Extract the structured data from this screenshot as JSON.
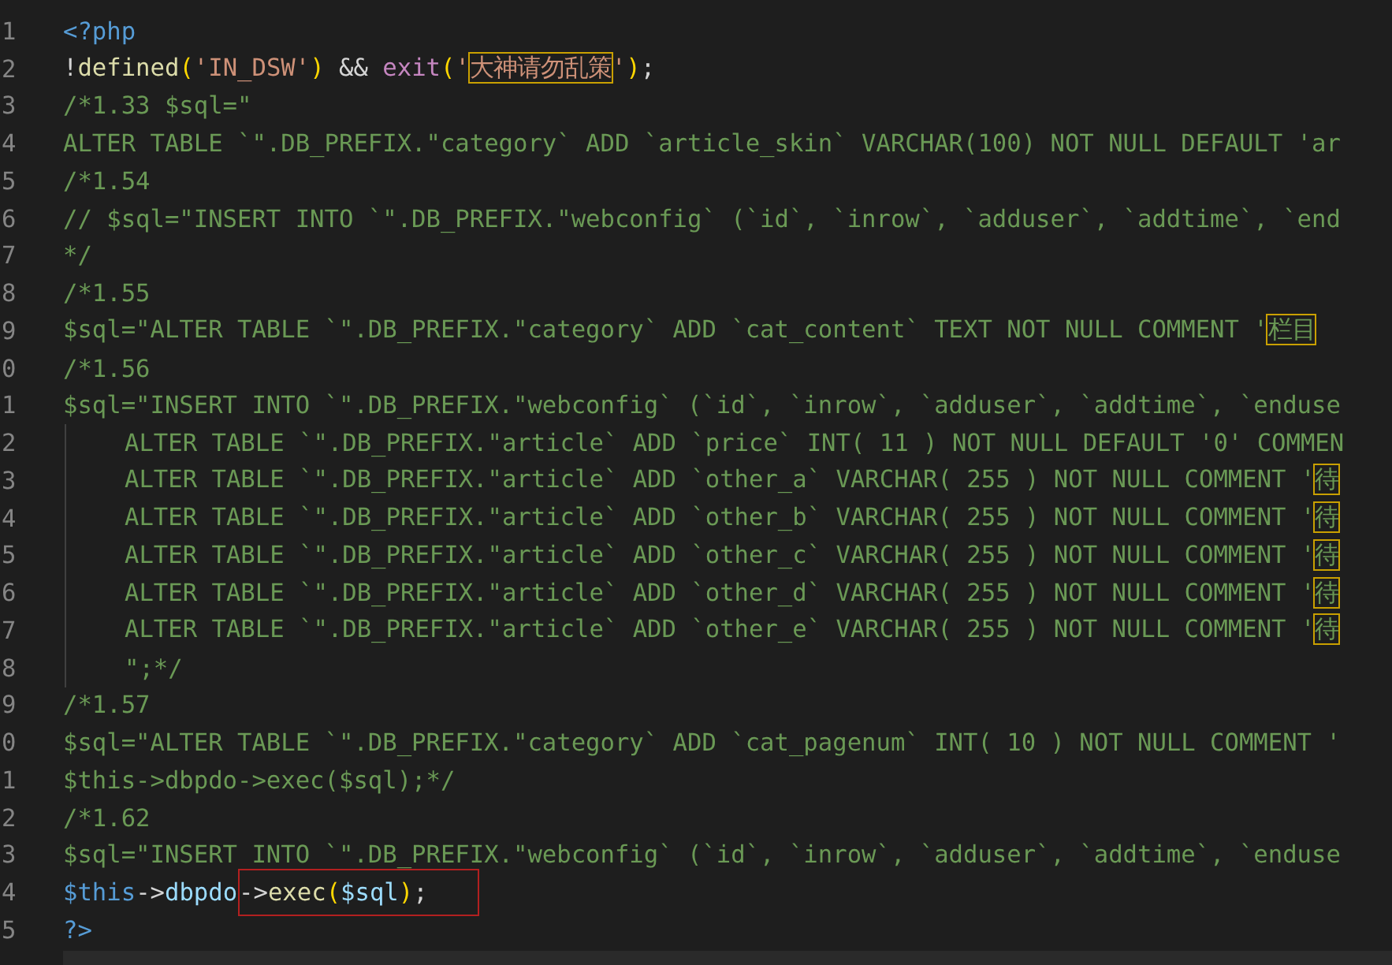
{
  "editor": {
    "lines": [
      {
        "number": "1",
        "indented": false,
        "tokens": [
          {
            "kind": "tag",
            "text": "<?php"
          }
        ]
      },
      {
        "number": "2",
        "indented": false,
        "tokens": [
          {
            "kind": "plain",
            "text": "!"
          },
          {
            "kind": "func",
            "text": "defined"
          },
          {
            "kind": "bracket",
            "text": "("
          },
          {
            "kind": "string",
            "text": "'IN_DSW'"
          },
          {
            "kind": "bracket",
            "text": ")"
          },
          {
            "kind": "plain",
            "text": " && "
          },
          {
            "kind": "control",
            "text": "exit"
          },
          {
            "kind": "bracket",
            "text": "("
          },
          {
            "kind": "string",
            "text": "'"
          },
          {
            "kind": "string-flagged",
            "text": "大神请勿乱策"
          },
          {
            "kind": "string",
            "text": "'"
          },
          {
            "kind": "bracket",
            "text": ")"
          },
          {
            "kind": "plain",
            "text": ";"
          }
        ]
      },
      {
        "number": "3",
        "indented": false,
        "tokens": [
          {
            "kind": "comment",
            "text": "/*1.33 $sql=\""
          }
        ]
      },
      {
        "number": "4",
        "indented": false,
        "tokens": [
          {
            "kind": "comment",
            "text": "ALTER TABLE `\".DB_PREFIX.\"category` ADD `article_skin` VARCHAR(100) NOT NULL DEFAULT 'ar"
          }
        ]
      },
      {
        "number": "5",
        "indented": false,
        "tokens": [
          {
            "kind": "comment",
            "text": "/*1.54"
          }
        ]
      },
      {
        "number": "6",
        "indented": false,
        "tokens": [
          {
            "kind": "comment",
            "text": "// $sql=\"INSERT INTO `\".DB_PREFIX.\"webconfig` (`id`, `inrow`, `adduser`, `addtime`, `end"
          }
        ]
      },
      {
        "number": "7",
        "indented": false,
        "tokens": [
          {
            "kind": "comment",
            "text": "*/"
          }
        ]
      },
      {
        "number": "8",
        "indented": false,
        "tokens": [
          {
            "kind": "comment",
            "text": "/*1.55"
          }
        ]
      },
      {
        "number": "9",
        "indented": false,
        "tokens": [
          {
            "kind": "comment",
            "text": "$sql=\"ALTER TABLE `\".DB_PREFIX.\"category` ADD `cat_content` TEXT NOT NULL COMMENT '"
          },
          {
            "kind": "comment-flagged",
            "text": "栏目"
          }
        ]
      },
      {
        "number": "0",
        "indented": false,
        "tokens": [
          {
            "kind": "comment",
            "text": "/*1.56"
          }
        ]
      },
      {
        "number": "1",
        "indented": false,
        "tokens": [
          {
            "kind": "comment",
            "text": "$sql=\"INSERT INTO `\".DB_PREFIX.\"webconfig` (`id`, `inrow`, `adduser`, `addtime`, `enduse"
          }
        ]
      },
      {
        "number": "2",
        "indented": true,
        "tokens": [
          {
            "kind": "comment",
            "text": "ALTER TABLE `\".DB_PREFIX.\"article` ADD `price` INT( 11 ) NOT NULL DEFAULT '0' COMMEN"
          }
        ]
      },
      {
        "number": "3",
        "indented": true,
        "tokens": [
          {
            "kind": "comment",
            "text": "ALTER TABLE `\".DB_PREFIX.\"article` ADD `other_a` VARCHAR( 255 ) NOT NULL COMMENT '"
          },
          {
            "kind": "comment-flagged",
            "text": "待"
          }
        ]
      },
      {
        "number": "4",
        "indented": true,
        "tokens": [
          {
            "kind": "comment",
            "text": "ALTER TABLE `\".DB_PREFIX.\"article` ADD `other_b` VARCHAR( 255 ) NOT NULL COMMENT '"
          },
          {
            "kind": "comment-flagged",
            "text": "待"
          }
        ]
      },
      {
        "number": "5",
        "indented": true,
        "tokens": [
          {
            "kind": "comment",
            "text": "ALTER TABLE `\".DB_PREFIX.\"article` ADD `other_c` VARCHAR( 255 ) NOT NULL COMMENT '"
          },
          {
            "kind": "comment-flagged",
            "text": "待"
          }
        ]
      },
      {
        "number": "6",
        "indented": true,
        "tokens": [
          {
            "kind": "comment",
            "text": "ALTER TABLE `\".DB_PREFIX.\"article` ADD `other_d` VARCHAR( 255 ) NOT NULL COMMENT '"
          },
          {
            "kind": "comment-flagged",
            "text": "待"
          }
        ]
      },
      {
        "number": "7",
        "indented": true,
        "tokens": [
          {
            "kind": "comment",
            "text": "ALTER TABLE `\".DB_PREFIX.\"article` ADD `other_e` VARCHAR( 255 ) NOT NULL COMMENT '"
          },
          {
            "kind": "comment-flagged",
            "text": "待"
          }
        ]
      },
      {
        "number": "8",
        "indented": true,
        "tokens": [
          {
            "kind": "comment",
            "text": "\";*/"
          }
        ]
      },
      {
        "number": "9",
        "indented": false,
        "tokens": [
          {
            "kind": "comment",
            "text": "/*1.57"
          }
        ]
      },
      {
        "number": "0",
        "indented": false,
        "tokens": [
          {
            "kind": "comment",
            "text": "$sql=\"ALTER TABLE `\".DB_PREFIX.\"category` ADD `cat_pagenum` INT( 10 ) NOT NULL COMMENT '"
          }
        ]
      },
      {
        "number": "1",
        "indented": false,
        "tokens": [
          {
            "kind": "comment",
            "text": "$this->dbpdo->exec($sql);*/"
          }
        ]
      },
      {
        "number": "2",
        "indented": false,
        "tokens": [
          {
            "kind": "comment",
            "text": "/*1.62"
          }
        ]
      },
      {
        "number": "3",
        "indented": false,
        "tokens": [
          {
            "kind": "comment",
            "text": "$sql=\"INSERT INTO `\".DB_PREFIX.\"webconfig` (`id`, `inrow`, `adduser`, `addtime`, `enduse"
          }
        ]
      },
      {
        "number": "4",
        "indented": false,
        "tokens": [
          {
            "kind": "tag",
            "text": "$this"
          },
          {
            "kind": "plain",
            "text": "->"
          },
          {
            "kind": "var",
            "text": "dbpdo"
          },
          {
            "kind": "callout",
            "tokens": [
              {
                "kind": "plain",
                "text": "->"
              },
              {
                "kind": "func",
                "text": "exec"
              },
              {
                "kind": "bracket",
                "text": "("
              },
              {
                "kind": "var",
                "text": "$sql"
              },
              {
                "kind": "bracket",
                "text": ")"
              },
              {
                "kind": "plain",
                "text": ";"
              }
            ]
          }
        ]
      },
      {
        "number": "5",
        "indented": false,
        "tokens": [
          {
            "kind": "tag",
            "text": "?>"
          }
        ]
      }
    ]
  }
}
